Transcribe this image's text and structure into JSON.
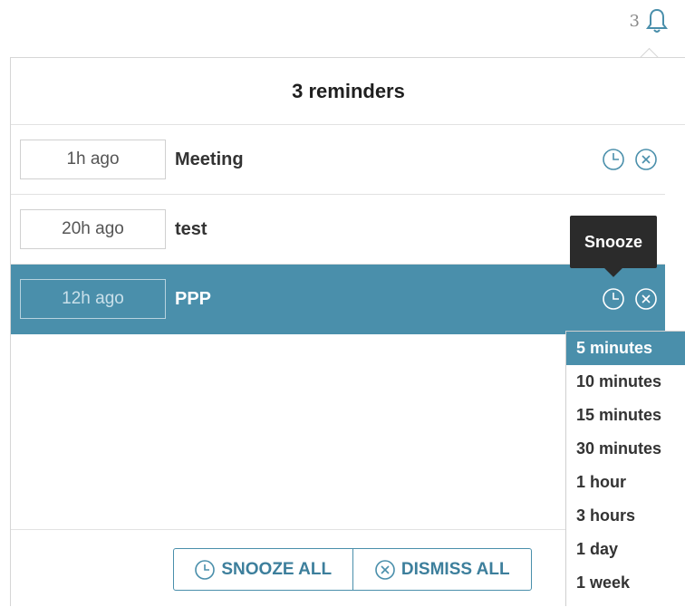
{
  "header": {
    "bell_count": "3"
  },
  "panel": {
    "title": "3 reminders"
  },
  "reminders": [
    {
      "time": "1h ago",
      "title": "Meeting",
      "selected": false
    },
    {
      "time": "20h ago",
      "title": "test",
      "selected": false
    },
    {
      "time": "12h ago",
      "title": "PPP",
      "selected": true
    }
  ],
  "tooltip": {
    "text": "Snooze"
  },
  "footer": {
    "snooze_all": "SNOOZE ALL",
    "dismiss_all": "DISMISS ALL"
  },
  "snooze_options": [
    "5 minutes",
    "10 minutes",
    "15 minutes",
    "30 minutes",
    "1 hour",
    "3 hours",
    "1 day",
    "1 week"
  ],
  "snooze_selected_index": 0,
  "colors": {
    "accent": "#4a8fab",
    "tooltip_bg": "#2b2b2b"
  },
  "icons": {
    "bell": "bell-icon",
    "snooze": "clock-icon",
    "dismiss": "close-circle-icon"
  }
}
